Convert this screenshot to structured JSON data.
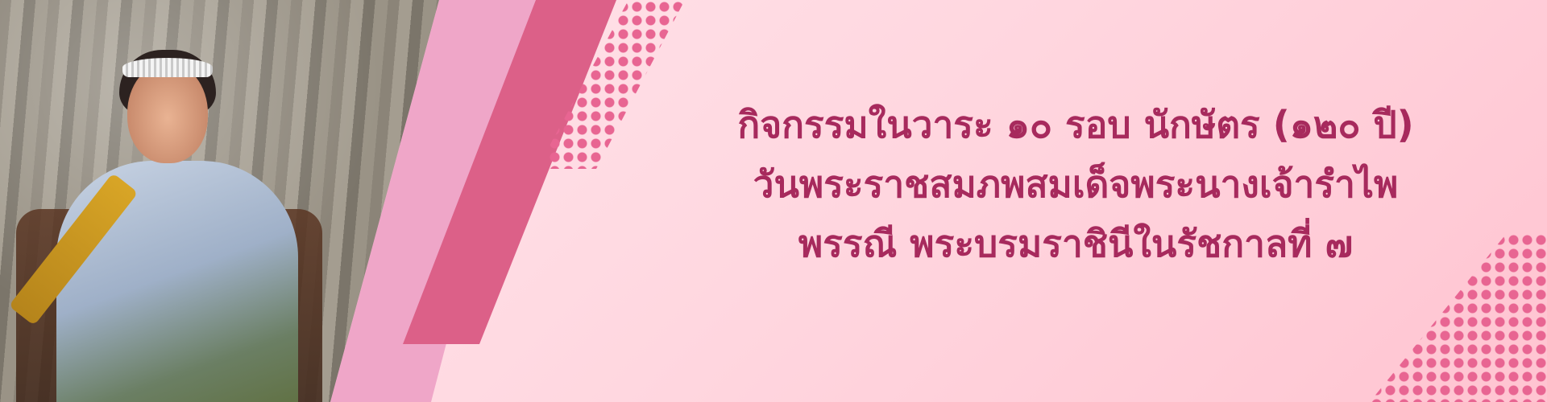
{
  "banner": {
    "title_lines": [
      "กิจกรรมในวาระ ๑๐ รอบ นักษัตร (๑๒๐ ปี)",
      "วันพระราชสมภพสมเด็จพระนางเจ้ารำไพ",
      "พรรณี พระบรมราชินีในรัชกาลที่ ๗"
    ]
  },
  "colors": {
    "title_text": "#a72a5d",
    "background": "#ffd6df",
    "stripe_light": "#efa6c8",
    "stripe_dark": "#dc6088",
    "dots": "#e86592"
  }
}
